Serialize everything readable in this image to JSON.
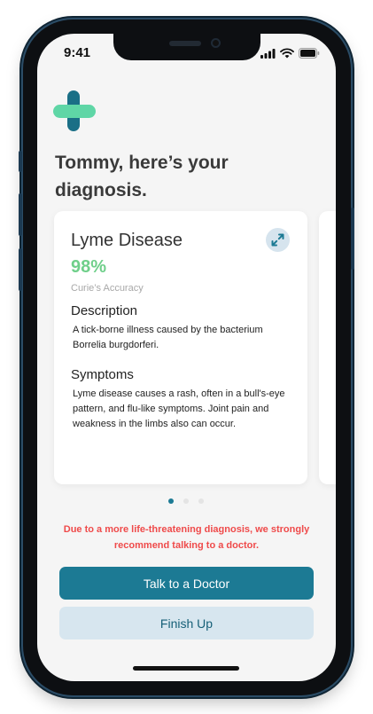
{
  "status_bar": {
    "time": "9:41"
  },
  "greeting": "Tommy, here’s your diagnosis.",
  "card": {
    "disease": "Lyme Disease",
    "accuracy": "98%",
    "accuracy_label": "Curie’s Accuracy",
    "description_heading": "Description",
    "description": "A tick-borne illness caused by the bacterium Borrelia burgdorferi.",
    "symptoms_heading": "Symptoms",
    "symptoms": "Lyme disease causes a rash, often in a bull's-eye pattern, and flu-like symptoms. Joint pain and weakness in the limbs also can occur."
  },
  "pagination": {
    "current": 1,
    "total": 3
  },
  "warning": "Due to a more life-threatening diagnosis, we strongly recommend talking to a doctor.",
  "buttons": {
    "primary": "Talk to a Doctor",
    "secondary": "Finish Up"
  },
  "colors": {
    "primary": "#1c7a94",
    "accent_green": "#5fd6a6",
    "accuracy_green": "#6fcf8a",
    "warning_red": "#ef4a4a",
    "secondary_bg": "#d7e6ef"
  },
  "icons": {
    "logo": "medical-cross-icon",
    "expand": "expand-icon",
    "signal": "signal-icon",
    "wifi": "wifi-icon",
    "battery": "battery-icon"
  }
}
